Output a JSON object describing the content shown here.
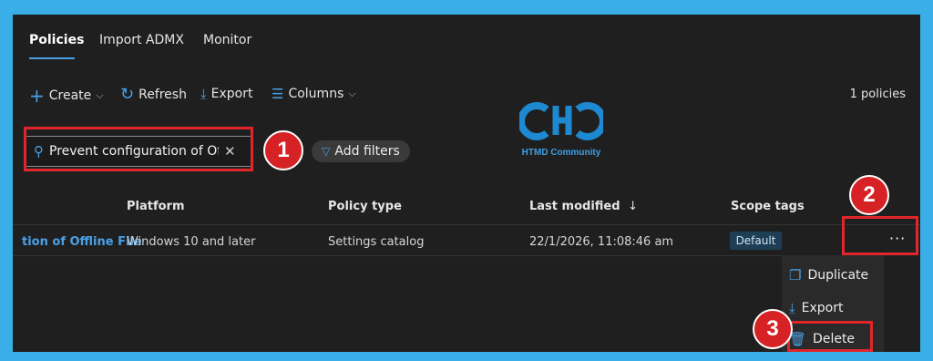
{
  "tabs": [
    {
      "label": "Policies",
      "active": true
    },
    {
      "label": "Import ADMX",
      "active": false
    },
    {
      "label": "Monitor",
      "active": false
    }
  ],
  "toolbar": {
    "create": "Create",
    "refresh": "Refresh",
    "export": "Export",
    "columns": "Columns",
    "count": "1 policies"
  },
  "search": {
    "value": "Prevent configuration of Off..."
  },
  "filters": {
    "add_label": "Add filters"
  },
  "watermark": {
    "text": "HTMD Community"
  },
  "table": {
    "columns": [
      "Platform",
      "Policy type",
      "Last modified",
      "Scope tags"
    ],
    "sort_indicator": "↓",
    "row": {
      "name": "tion of Offline File",
      "platform": "Windows 10 and later",
      "policy_type": "Settings catalog",
      "last_modified": "22/1/2026, 11:08:46 am",
      "scope_tag": "Default",
      "more": "···"
    }
  },
  "context_menu": {
    "items": [
      "Duplicate",
      "Export",
      "Delete"
    ]
  },
  "markers": [
    "1",
    "2",
    "3"
  ],
  "colors": {
    "accent": "#4aa0e6",
    "highlight": "#e0262b",
    "frame": "#3aaee6",
    "background": "#1f1f1f"
  }
}
